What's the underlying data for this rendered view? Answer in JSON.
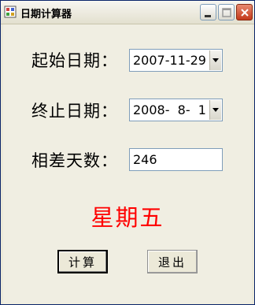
{
  "window": {
    "title": "日期计算器"
  },
  "form": {
    "start_label": "起始日期：",
    "start_value": "2007-11-29",
    "end_label": "终止日期：",
    "end_value": "2008-  8-  1",
    "diff_label": "相差天数：",
    "diff_value": "246"
  },
  "result": {
    "weekday": "星期五",
    "color": "#ff0000"
  },
  "buttons": {
    "calc": "计算",
    "exit": "退出"
  },
  "icons": {
    "app": "calculator-app-icon",
    "minimize": "minimize-icon",
    "maximize": "maximize-icon",
    "close": "close-icon"
  }
}
